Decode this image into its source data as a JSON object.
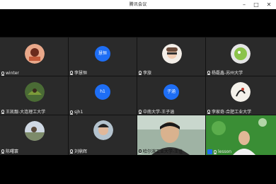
{
  "window": {
    "title": "腾讯会议"
  },
  "participants": [
    {
      "name": "winter",
      "avatar": "pink-fantasy",
      "muted": true
    },
    {
      "name": "李慧恒",
      "avatar": "blue-text",
      "initial": "慧恒",
      "muted": true
    },
    {
      "name": "李旅",
      "avatar": "anime-glasses",
      "muted": true
    },
    {
      "name": "杨磊鑫-苏州大学",
      "avatar": "green-cartoon",
      "muted": true
    },
    {
      "name": "王凯靓-大连理工大学",
      "avatar": "nature-photo",
      "muted": true
    },
    {
      "name": "sjh1",
      "avatar": "blue-text",
      "initial": "h1",
      "muted": true
    },
    {
      "name": "中南大学-王子涵",
      "avatar": "blue-text",
      "initial": "子涵",
      "muted": true
    },
    {
      "name": "李家奇-合肥工业大学",
      "avatar": "ink-bird",
      "muted": true
    },
    {
      "name": "陈曙寰",
      "avatar": "landscape",
      "muted": true
    },
    {
      "name": "刘鼎辉",
      "avatar": "anime-portrait",
      "muted": true
    },
    {
      "name": "哈尔滨工业大学-王佳",
      "avatar": "video-man",
      "muted": true
    },
    {
      "name": "lesson",
      "avatar": "video-green",
      "muted": false,
      "host": true
    }
  ],
  "colors": {
    "tile_bg": "#2a2a2a",
    "avatar_blue": "#1e6ef5",
    "green": "#1fb04b"
  }
}
